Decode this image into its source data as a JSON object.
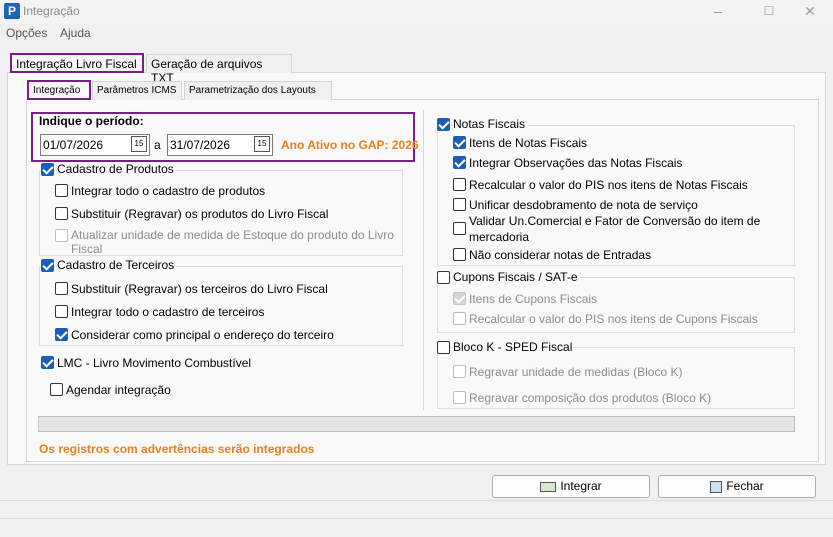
{
  "window": {
    "title": "Integração",
    "minimize": "–",
    "maximize": "☐",
    "close": "✕"
  },
  "menu": [
    "Opções",
    "Ajuda"
  ],
  "outer_tabs": [
    "Integração Livro Fiscal",
    "Geração de arquivos TXT"
  ],
  "inner_tabs": [
    "Integração",
    "Parâmetros ICMS",
    "Parametrização dos Layouts"
  ],
  "period": {
    "label": "Indique o período:",
    "start": "01/07/2026",
    "separator": "a",
    "end": "31/07/2026",
    "notice": "Ano Ativo no GAP: 2026"
  },
  "produtos": {
    "title": "Cadastro de Produtos",
    "checked": true,
    "items": [
      {
        "label": "Integrar todo o cadastro de produtos",
        "checked": false,
        "enabled": true
      },
      {
        "label": "Substituir (Regravar) os produtos do Livro Fiscal",
        "checked": false,
        "enabled": true
      },
      {
        "label": "Atualizar unidade de medida de Estoque do produto do Livro",
        "label2": "Fiscal",
        "checked": false,
        "enabled": false
      }
    ]
  },
  "terceiros": {
    "title": "Cadastro de Terceiros",
    "checked": true,
    "items": [
      {
        "label": "Substituir (Regravar) os terceiros do Livro Fiscal",
        "checked": false,
        "enabled": true
      },
      {
        "label": "Integrar todo o cadastro de terceiros",
        "checked": false,
        "enabled": true
      },
      {
        "label": "Considerar como principal o endereço do terceiro",
        "checked": true,
        "enabled": true
      }
    ]
  },
  "lmc": {
    "label": "LMC - Livro Movimento Combustível",
    "checked": true
  },
  "agendar": {
    "label": "Agendar integração",
    "checked": false
  },
  "notas": {
    "title": "Notas Fiscais",
    "checked": true,
    "items": [
      {
        "label": "Itens de Notas Fiscais",
        "checked": true,
        "enabled": true
      },
      {
        "label": "Integrar Observações das Notas Fiscais",
        "checked": true,
        "enabled": true
      },
      {
        "label": "Recalcular o valor do PIS nos itens de Notas Fiscais",
        "checked": false,
        "enabled": true
      },
      {
        "label": "Unificar desdobramento de nota de serviço",
        "checked": false,
        "enabled": true
      },
      {
        "label": "Validar Un.Comercial e Fator de Conversão do item de",
        "label2": "mercadoria",
        "checked": false,
        "enabled": true
      },
      {
        "label": "Não considerar notas de Entradas",
        "checked": false,
        "enabled": true
      }
    ]
  },
  "cupons": {
    "title": "Cupons Fiscais / SAT-e",
    "checked": false,
    "items": [
      {
        "label": "Itens de Cupons Fiscais",
        "checked": true,
        "enabled": false
      },
      {
        "label": "Recalcular o valor do PIS nos itens de Cupons Fiscais",
        "checked": false,
        "enabled": false
      }
    ]
  },
  "blocok": {
    "title": "Bloco K - SPED Fiscal",
    "checked": false,
    "items": [
      {
        "label": "Regravar unidade de medidas (Bloco K)",
        "checked": false,
        "enabled": false
      },
      {
        "label": "Regravar composição dos produtos (Bloco K)",
        "checked": false,
        "enabled": false
      }
    ]
  },
  "warning": "Os registros com advertências serão integrados",
  "buttons": {
    "integrar": "Integrar",
    "fechar": "Fechar"
  },
  "colors": {
    "accent": "#1a5fb4",
    "highlight": "#7a1f87",
    "warning": "#e8801c"
  }
}
